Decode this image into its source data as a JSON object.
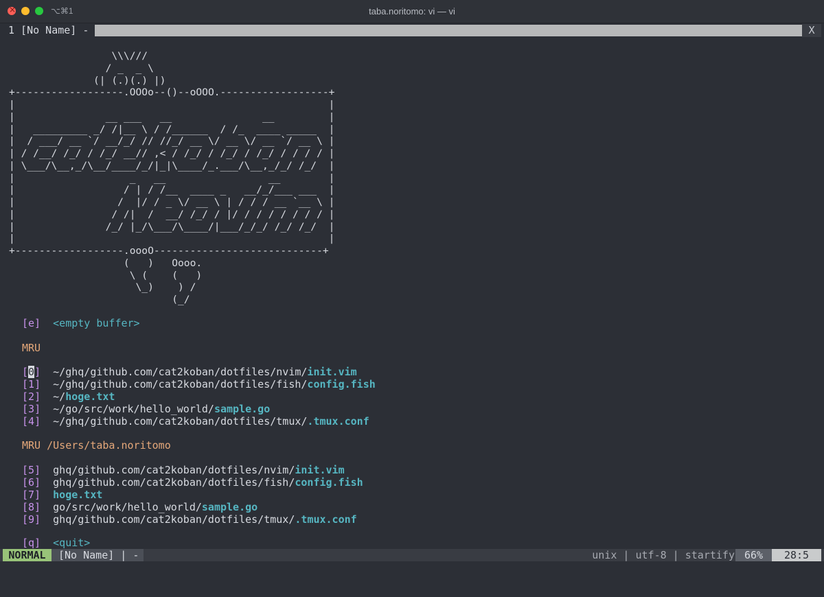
{
  "window": {
    "title": "taba.noritomo: vi — vi",
    "shortcut": "⌥⌘1"
  },
  "tabline": {
    "active_tab": "1 [No Name] -",
    "close_label": "X"
  },
  "startify": {
    "ascii_art": "                 \\\\\\///\n                / _  _ \\\n              (| (.)(.) |)\n+------------------.OOOo--()--oOOO.------------------+\n|                                                    |\n|               __ ___   __               __         |\n|   _________ _/ /|__ \\ / /______  / /_  ____ _____  |\n|  / ___/ __ `/ __/_/ // //_/ __ \\/ __ \\/ __ `/ __ \\ |\n| / /__/ /_/ / /_/ __// ,< / /_/ / /_/ / /_/ / / / / |\n| \\___/\\__,_/\\__/____/_/|_|\\____/_.___/\\__,_/_/ /_/  |\n|                   _   __                 __        |\n|                  / | / /__  ____ _   __/_/___ ___  |\n|                 /  |/ / _ \\/ __ \\ | / / / __ `__ \\ |\n|                / /|  /  __/ /_/ / |/ / / / / / / / |\n|               /_/ |_/\\___/\\____/|___/_/_/ /_/ /_/  |\n|                                                    |\n+------------------.oooO----------------------------+\n                   (   )   Oooo.\n                    \\ (    (   )\n                     \\_)    ) /\n                           (_/",
    "empty_buffer": {
      "key": "[e]",
      "label": "<empty buffer>"
    },
    "mru_header": "MRU",
    "mru": [
      {
        "key_open": "[",
        "key_num": "0",
        "key_close": "]",
        "dir": "~/ghq/github.com/cat2koban/dotfiles/nvim/",
        "file": "init.vim"
      },
      {
        "key_open": "[",
        "key_num": "1",
        "key_close": "]",
        "dir": "~/ghq/github.com/cat2koban/dotfiles/fish/",
        "file": "config.fish"
      },
      {
        "key_open": "[",
        "key_num": "2",
        "key_close": "]",
        "dir": "~/",
        "file": "hoge.txt"
      },
      {
        "key_open": "[",
        "key_num": "3",
        "key_close": "]",
        "dir": "~/go/src/work/hello_world/",
        "file": "sample.go"
      },
      {
        "key_open": "[",
        "key_num": "4",
        "key_close": "]",
        "dir": "~/ghq/github.com/cat2koban/dotfiles/tmux/",
        "file": ".tmux.conf"
      }
    ],
    "mru_dir_header": "MRU /Users/taba.noritomo",
    "mru_dir": [
      {
        "key": "[5]",
        "dir": "ghq/github.com/cat2koban/dotfiles/nvim/",
        "file": "init.vim"
      },
      {
        "key": "[6]",
        "dir": "ghq/github.com/cat2koban/dotfiles/fish/",
        "file": "config.fish"
      },
      {
        "key": "[7]",
        "dir": "",
        "file": "hoge.txt"
      },
      {
        "key": "[8]",
        "dir": "go/src/work/hello_world/",
        "file": "sample.go"
      },
      {
        "key": "[9]",
        "dir": "ghq/github.com/cat2koban/dotfiles/tmux/",
        "file": ".tmux.conf"
      }
    ],
    "quit": {
      "key": "[q]",
      "label": "<quit>"
    }
  },
  "statusline": {
    "mode": "NORMAL",
    "buffer": "[No Name] | -",
    "fileinfo": "unix | utf-8 | startify",
    "percent": "66%",
    "position": "28:5"
  },
  "colors": {
    "background": "#2c2f36",
    "mode_normal": "#98c379",
    "index_purple": "#c792ea",
    "file_cyan": "#56b6c2",
    "header_orange": "#e5a87a"
  }
}
